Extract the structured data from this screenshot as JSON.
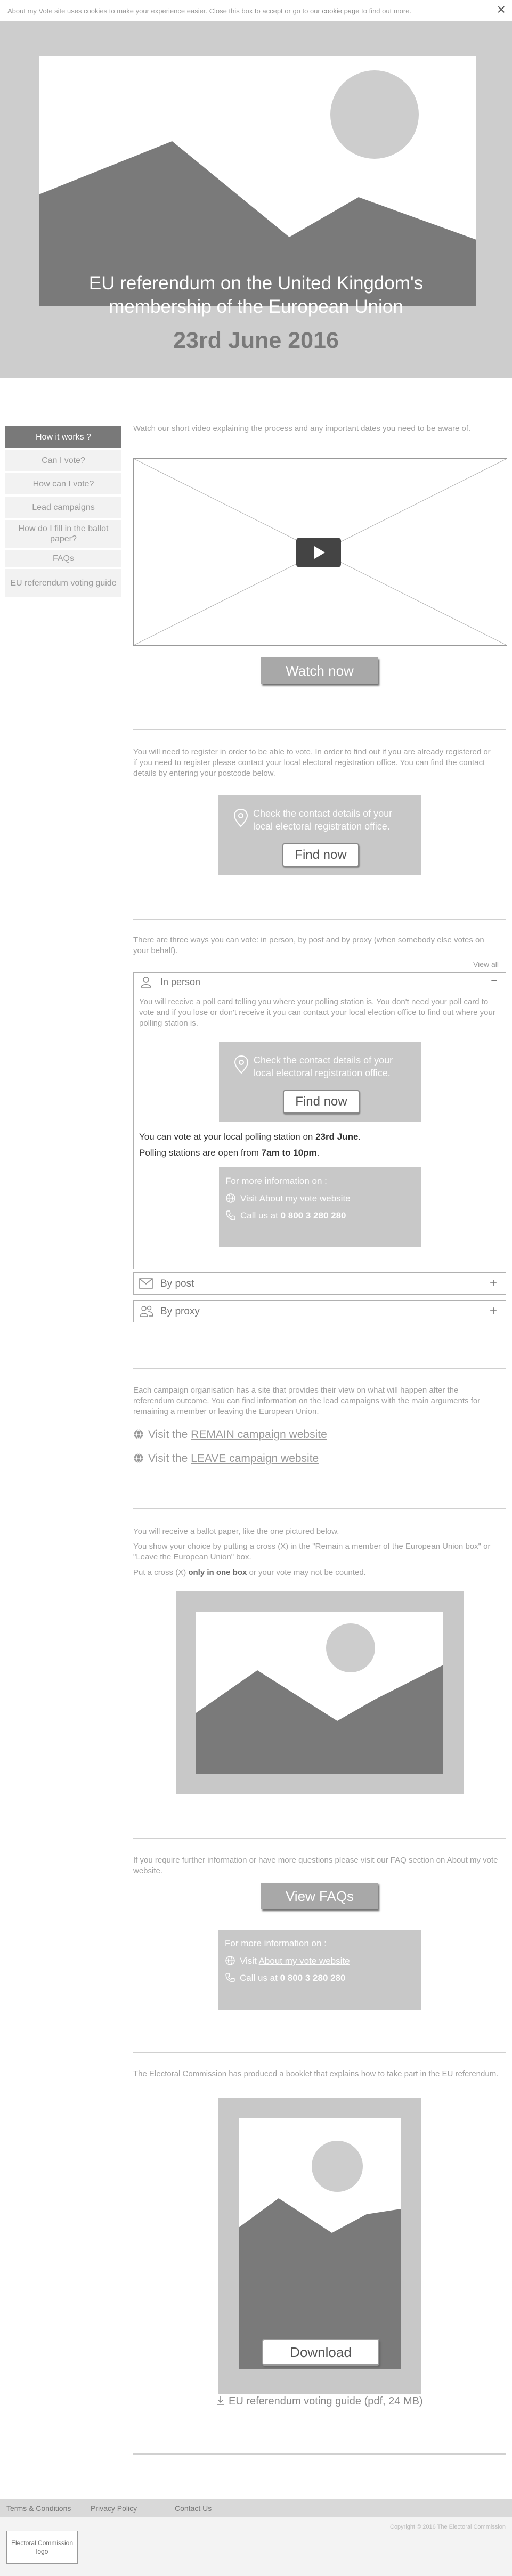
{
  "cookie": {
    "text_before": "About my Vote site uses cookies to make your experience easier. Close this box to accept or go to our ",
    "link": "cookie page",
    "text_after": " to find out more.",
    "close": "×"
  },
  "hero": {
    "caption_line1": "EU referendum on the United Kingdom's",
    "caption_line2": "membership of the European Union",
    "date": "23rd June 2016"
  },
  "sidebar": {
    "items": [
      {
        "label": "How it works ?"
      },
      {
        "label": "Can I vote?"
      },
      {
        "label": "How can I vote?"
      },
      {
        "label": "Lead campaigns"
      },
      {
        "label": "How do I fill in the ballot paper?"
      },
      {
        "label": "FAQs"
      },
      {
        "label": "EU referendum voting guide"
      }
    ]
  },
  "video": {
    "intro": "Watch our short video explaining the process and any important dates you need to be aware of.",
    "button": "Watch now"
  },
  "register": {
    "intro": "You will need to register in order to be able to vote. In order to find out if you are already registered or if you need to register please contact your local electoral registration office. You can find the contact details by entering your postcode below.",
    "box_text": "Check the contact details of your local electoral registration office.",
    "button": "Find now"
  },
  "ways": {
    "intro": "There are three ways you can vote: in person, by post and by proxy (when somebody else votes on your behalf).",
    "view_all": "View all",
    "in_person": {
      "title": "In person",
      "toggle": "−",
      "desc": "You will receive a poll card telling you where your polling station is. You don't need your poll card to vote and if you lose or don't receive it you can contact your local election office to find out where your polling station is.",
      "box_text": "Check the contact details of your local electoral registration office.",
      "button": "Find now",
      "vote_pre": "You can vote at your local polling station on ",
      "vote_date": "23rd June",
      "vote_post": ".",
      "hours_pre": "Polling stations are open from ",
      "hours": "7am to 10pm",
      "hours_post": ".",
      "info_title": "For more information on :",
      "visit_pre": "Visit ",
      "visit_link": "About my vote website",
      "call_pre": "Call us at ",
      "phone": "0 800 3 280 280"
    },
    "by_post": {
      "title": "By post",
      "toggle": "+"
    },
    "by_proxy": {
      "title": "By proxy",
      "toggle": "+"
    }
  },
  "campaigns": {
    "intro": "Each campaign organisation has a site that provides their view on what will happen after the referendum outcome. You can find information on the lead campaigns with the main arguments for remaining a member or leaving the European Union.",
    "remain_pre": "Visit the ",
    "remain_link": "REMAIN campaign website",
    "leave_pre": "Visit the ",
    "leave_link": "LEAVE campaign website"
  },
  "ballot": {
    "line1": "You will receive a ballot paper, like the one pictured below.",
    "line2": "You show your choice by putting a cross (X) in the \"Remain a member of the European Union box\" or \"Leave the European Union\" box.",
    "line3_pre": "Put a cross (X) ",
    "line3_bold": "only in one box",
    "line3_post": " or your vote may not be counted."
  },
  "faq": {
    "intro": "If you require further information or have more questions please visit our FAQ section on About my vote website.",
    "button": "View FAQs",
    "info_title": "For more information on :",
    "visit_pre": "Visit ",
    "visit_link": "About my vote website",
    "call_pre": "Call us at ",
    "phone": "0 800 3 280 280"
  },
  "guide": {
    "intro": "The Electoral Commission has produced a booklet that explains how to take part in the EU referendum.",
    "button": "Download",
    "file": "EU referendum voting guide (pdf, 24 MB)"
  },
  "footer": {
    "links": [
      "Terms & Conditions",
      "Privacy Policy",
      "Contact Us"
    ],
    "logo": "Electoral Commission logo",
    "copyright": "Copyright © 2016 The Electoral Commission"
  }
}
